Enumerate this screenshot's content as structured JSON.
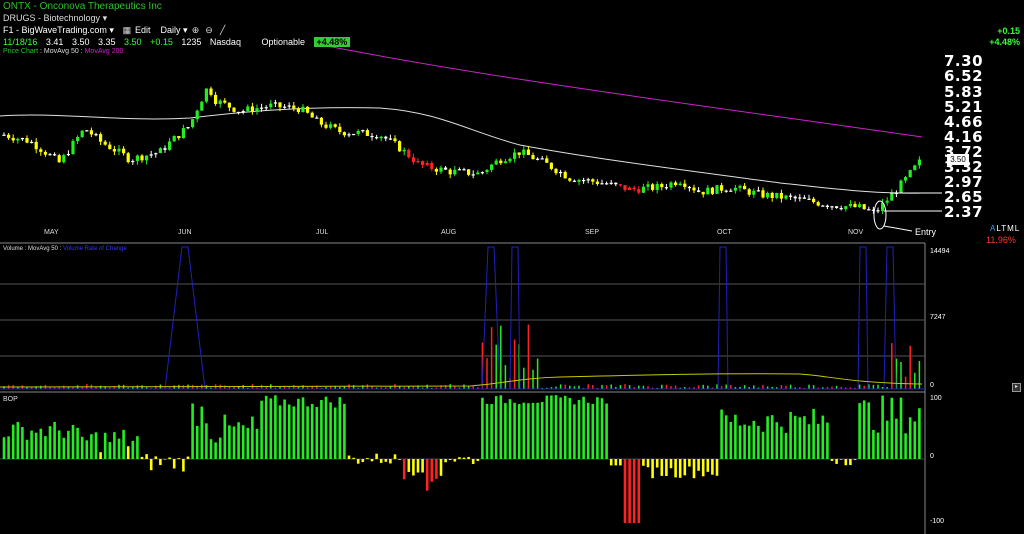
{
  "header": {
    "title": "ONTX - Onconova Therapeutics Inc",
    "sector": "DRUGS - Biotechnology",
    "account": "F1 - BigWaveTrading.com",
    "edit_label": "Edit",
    "interval": "Daily",
    "quote": {
      "date": "11/18/16",
      "open": "3.41",
      "high": "3.50",
      "low": "3.35",
      "close": "3.50",
      "change": "+0.15",
      "volume": "1235",
      "exchange": "Nasdaq",
      "optionable": "Optionable",
      "pct_badge": "+4.48%"
    },
    "right_change": "+0.15",
    "right_pct": "+4.48%"
  },
  "legends": {
    "price": "Price Chart",
    "ma50": "MovAvg 50",
    "ma200": "MovAvg 200",
    "volume": "Volume",
    "vol_ma": "MovAvg 50",
    "vol_extra": "Volume Rate of Change",
    "bop": "BOP"
  },
  "price_axis": {
    "ticks": [
      "7.30",
      "6.52",
      "5.83",
      "5.21",
      "4.66",
      "4.16",
      "3.72",
      "3.32",
      "2.97",
      "2.65",
      "2.37"
    ],
    "last": "3.50"
  },
  "months": [
    "MAY",
    "JUN",
    "JUL",
    "AUG",
    "SEP",
    "OCT",
    "NOV"
  ],
  "annotation": {
    "entry": "Entry"
  },
  "right_panel": {
    "modes": "ALTML",
    "mode_active": "A",
    "modes_rest": "LTML",
    "pct": "11.96%"
  },
  "volume_axis": {
    "top": "14494",
    "mid": "7247",
    "zero": "0"
  },
  "bop_axis": {
    "top": "100",
    "zero": "0",
    "bottom": "-100"
  },
  "colors": {
    "up": "#22ee22",
    "flat": "#ffff00",
    "down": "#ff2222",
    "ma50": "#e0e0e0",
    "ma200": "#cc22cc",
    "vol_line": "#2020c0",
    "vol_ma": "#c8c800"
  },
  "chart_data": {
    "type": "candlestick",
    "title": "ONTX - Onconova Therapeutics Inc",
    "series": [
      {
        "name": "Price Chart",
        "type": "candlestick",
        "approx_close_by_month": {
          "MAY": 3.9,
          "JUN": 4.9,
          "JUL": 4.3,
          "AUG": 3.2,
          "SEP": 3.0,
          "OCT": 2.8,
          "NOV": 3.5
        }
      },
      {
        "name": "MovAvg 50",
        "type": "line"
      },
      {
        "name": "MovAvg 200",
        "type": "line"
      },
      {
        "name": "Volume",
        "type": "bar"
      },
      {
        "name": "BOP",
        "type": "bar",
        "range": [
          -100,
          100
        ]
      }
    ],
    "y_ticks": [
      7.3,
      6.52,
      5.83,
      5.21,
      4.66,
      4.16,
      3.72,
      3.32,
      2.97,
      2.65,
      2.37
    ],
    "last_price": 3.5
  }
}
